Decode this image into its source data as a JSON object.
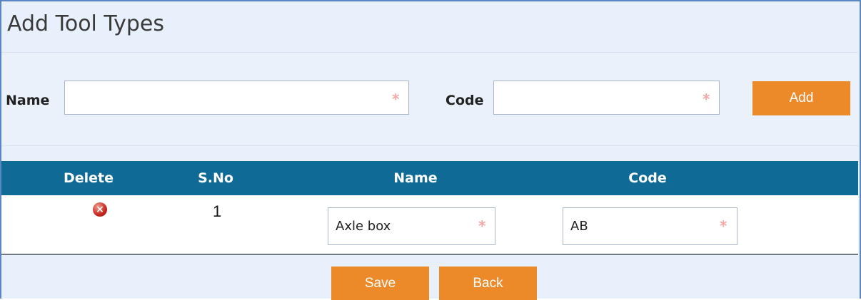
{
  "page": {
    "title": "Add Tool Types"
  },
  "form": {
    "name_label": "Name",
    "name_value": "",
    "code_label": "Code",
    "code_value": "",
    "required_mark": "*",
    "add_label": "Add"
  },
  "grid": {
    "columns": [
      "Delete",
      "S.No",
      "Name",
      "Code"
    ],
    "rows": [
      {
        "sno": "1",
        "name": "Axle box",
        "code": "AB"
      }
    ]
  },
  "footer": {
    "save_label": "Save",
    "back_label": "Back"
  },
  "colors": {
    "header_bar": "#0f6a96",
    "button": "#ec8a2a",
    "panel_border": "#5b86c6",
    "panel_bg": "#e8f0fb",
    "required_mark": "#f4a6a6",
    "delete_icon": "#c4281e"
  },
  "icons": {
    "delete": "delete-circle-x-icon"
  }
}
